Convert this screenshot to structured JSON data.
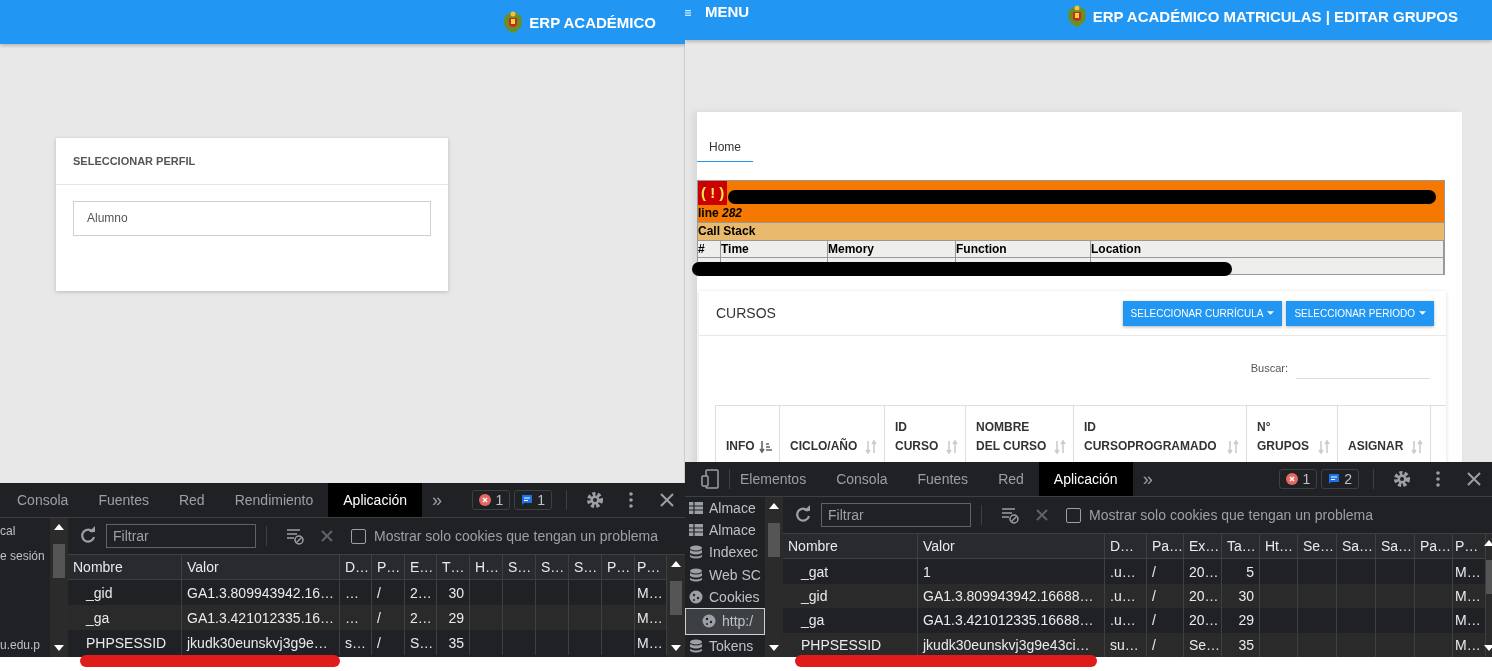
{
  "left_window": {
    "header": {
      "title": "ERP ACADÉMICO"
    },
    "profile_card": {
      "title": "SELECCIONAR PERFIL",
      "select": {
        "value": "Alumno"
      }
    },
    "devtools": {
      "tabs": [
        {
          "label": "Consola",
          "selected": false
        },
        {
          "label": "Fuentes",
          "selected": false
        },
        {
          "label": "Red",
          "selected": false
        },
        {
          "label": "Rendimiento",
          "selected": false
        },
        {
          "label": "Aplicación",
          "selected": true
        }
      ],
      "more_tabs": "»",
      "error_count": "1",
      "message_count": "1",
      "sidebar": [
        {
          "label": "cal",
          "kind": "section"
        },
        {
          "label": "e sesión",
          "kind": "section"
        },
        {
          "label": "u.edu.p",
          "kind": "origin"
        }
      ],
      "filter": {
        "placeholder": "Filtrar"
      },
      "problem_filter": {
        "label": "Mostrar solo cookies que tengan un problema",
        "checked": false
      },
      "columns": [
        "Nombre",
        "Valor",
        "D…",
        "P…",
        "E…",
        "T…",
        "H…",
        "S…",
        "S…",
        "S…",
        "P…",
        "P…"
      ],
      "rows": [
        {
          "cells": [
            "_gid",
            "GA1.3.809943942.16…",
            "…",
            "/",
            "2…",
            "30"
          ],
          "column_12": "M…"
        },
        {
          "cells": [
            "_ga",
            "GA1.3.421012335.16…",
            "…",
            "/",
            "2…",
            "29"
          ],
          "column_12": "M…"
        },
        {
          "cells": [
            "PHPSESSID",
            "jkudk30eunskvj3g9e…",
            "s…",
            "/",
            "S…",
            "35"
          ],
          "column_12": "M…"
        }
      ]
    }
  },
  "right_window": {
    "header": {
      "menu_label": "MENU",
      "title": "ERP ACADÉMICO MATRICULAS | EDITAR GRUPOS"
    },
    "nav_tabs": [
      {
        "label": "Home",
        "selected": true
      }
    ],
    "error_notice": {
      "icon": "( ! )",
      "line": "line *282*",
      "call_stack_title": "Call Stack",
      "columns": [
        "#",
        "Time",
        "Memory",
        "Function",
        "Location"
      ]
    },
    "courses_card": {
      "title": "CURSOS",
      "buttons": [
        {
          "label": "SELECCIONAR CURRÍCULA"
        },
        {
          "label": "SELECCIONAR PERIODO"
        }
      ],
      "search": {
        "label": "Buscar:"
      },
      "columns": [
        {
          "lines": [
            "INFO"
          ],
          "sorted": true
        },
        {
          "lines": [
            "CICLO/AÑO"
          ],
          "sorted": false
        },
        {
          "lines": [
            "ID",
            "CURSO"
          ],
          "sorted": false
        },
        {
          "lines": [
            "NOMBRE",
            "DEL CURSO"
          ],
          "sorted": false
        },
        {
          "lines": [
            "ID",
            "CURSOPROGRAMADO"
          ],
          "sorted": false
        },
        {
          "lines": [
            "N°",
            "GRUPOS"
          ],
          "sorted": false
        },
        {
          "lines": [
            "ASIGNAR"
          ],
          "sorted": false
        }
      ]
    },
    "devtools": {
      "tabs": [
        {
          "label": "Elementos",
          "selected": false
        },
        {
          "label": "Consola",
          "selected": false
        },
        {
          "label": "Fuentes",
          "selected": false
        },
        {
          "label": "Red",
          "selected": false
        },
        {
          "label": "Aplicación",
          "selected": true
        }
      ],
      "more_tabs": "»",
      "error_count": "1",
      "message_count": "2",
      "sidebar": [
        {
          "label": "Almace",
          "kind": "table",
          "selected": false
        },
        {
          "label": "Almace",
          "kind": "table",
          "selected": false
        },
        {
          "label": "Indexec",
          "kind": "database",
          "selected": false
        },
        {
          "label": "Web SC",
          "kind": "database",
          "selected": false
        },
        {
          "label": "Cookies",
          "kind": "cookie",
          "selected": false,
          "children": [
            {
              "label": "http:/",
              "kind": "cookie",
              "selected": true
            }
          ]
        },
        {
          "label": "Tokens",
          "kind": "database",
          "selected": false
        }
      ],
      "filter": {
        "placeholder": "Filtrar"
      },
      "problem_filter": {
        "label": "Mostrar solo cookies que tengan un problema",
        "checked": false
      },
      "columns": [
        "Nombre",
        "Valor",
        "D…",
        "Pa…",
        "Ex…",
        "Ta…",
        "Ht…",
        "Se…",
        "Sa…",
        "Sa…",
        "Pa…",
        "P…"
      ],
      "rows": [
        {
          "cells": [
            "_gat",
            "1",
            ".u…",
            "/",
            "20…",
            "5"
          ],
          "column_12": "M…"
        },
        {
          "cells": [
            "_gid",
            "GA1.3.809943942.16688…",
            ".u…",
            "/",
            "20…",
            "30"
          ],
          "column_12": "M…"
        },
        {
          "cells": [
            "_ga",
            "GA1.3.421012335.16688…",
            ".u…",
            "/",
            "20…",
            "29"
          ],
          "column_12": "M…"
        },
        {
          "cells": [
            "PHPSESSID",
            "jkudk30eunskvj3g9e43ci…",
            "su…",
            "/",
            "Se…",
            "35"
          ],
          "column_12": "M…"
        }
      ]
    }
  }
}
